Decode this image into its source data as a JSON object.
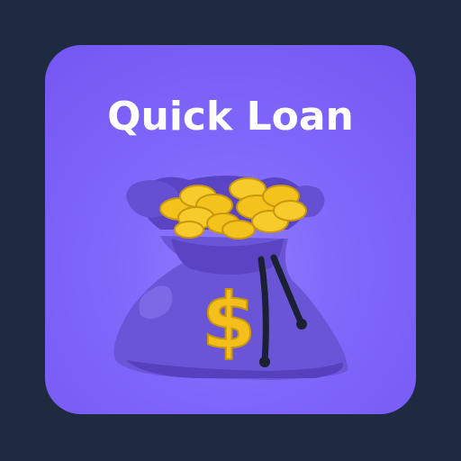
{
  "app": {
    "title": "Quick Loan",
    "icon": "money-bag-with-gold-coins-icon",
    "currency_symbol": "$"
  },
  "colors": {
    "page_background": "#1e2a40",
    "tile_background": "#7c63f7",
    "bag": "#5f48c8",
    "coin_gold": "#f5c518",
    "dollar_sign": "#f4bf1a",
    "rope": "#1a1f33",
    "title_text": "#ffffff"
  }
}
